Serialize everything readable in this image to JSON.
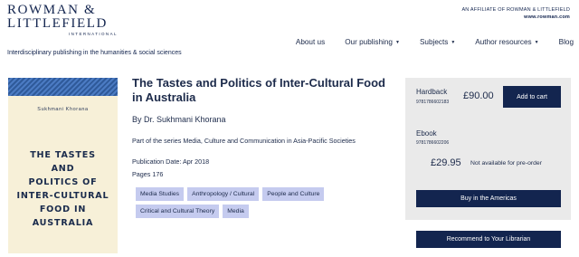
{
  "header": {
    "logo_line1": "ROWMAN &",
    "logo_line2": "LITTLEFIELD",
    "logo_sub": "INTERNATIONAL",
    "tagline": "Interdisciplinary publishing in the humanities & social sciences",
    "affiliate_text": "AN AFFILIATE OF ROWMAN & LITTLEFIELD",
    "affiliate_url": "www.rowman.com"
  },
  "nav": {
    "items": [
      {
        "label": "About us",
        "dropdown": false
      },
      {
        "label": "Our publishing",
        "dropdown": true
      },
      {
        "label": "Subjects",
        "dropdown": true
      },
      {
        "label": "Author resources",
        "dropdown": true
      },
      {
        "label": "Blog",
        "dropdown": false
      }
    ]
  },
  "cover": {
    "author": "Sukhmani Khorana",
    "title_lines": [
      "THE TASTES",
      "AND",
      "POLITICS OF",
      "INTER-CULTURAL",
      "FOOD IN",
      "AUSTRALIA"
    ],
    "background_color": "#f7f0d8",
    "band_color": "#2f5a9a"
  },
  "book": {
    "title": "The Tastes and Politics of Inter-Cultural Food in Australia",
    "byline": "By Dr. Sukhmani Khorana",
    "series": "Part of the series Media, Culture and Communication in Asia-Pacific Societies",
    "publication_date": "Publication Date: Apr 2018",
    "pages": "Pages 176",
    "tags": [
      "Media Studies",
      "Anthropology / Cultural",
      "People and Culture",
      "Critical and Cultural Theory",
      "Media"
    ]
  },
  "purchase": {
    "hardback": {
      "label": "Hardback",
      "isbn": "9781786602183",
      "price": "£90.00",
      "button": "Add to cart"
    },
    "ebook": {
      "label": "Ebook",
      "isbn": "9781786602206",
      "price": "£29.95",
      "status": "Not available for pre-order"
    },
    "americas_button": "Buy in the Americas",
    "librarian_button": "Recommend to Your Librarian"
  },
  "colors": {
    "brand_navy": "#13254f",
    "tag_bg": "#c5cbef",
    "panel_bg": "#eaeaea"
  }
}
